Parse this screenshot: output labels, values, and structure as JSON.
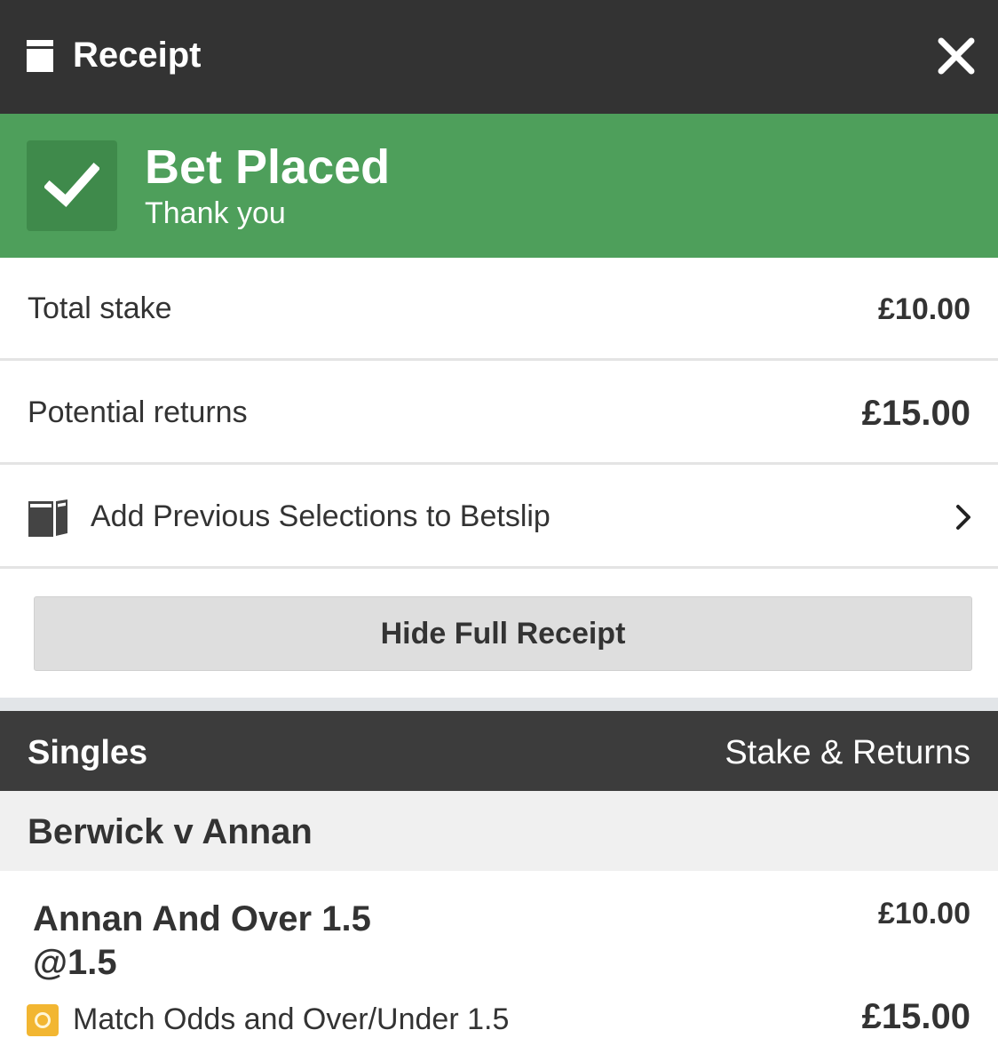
{
  "header": {
    "title": "Receipt",
    "icons": {
      "receipt": "receipt-icon",
      "close": "close-icon"
    }
  },
  "banner": {
    "title": "Bet Placed",
    "subtitle": "Thank you",
    "icon": "checkmark-icon",
    "color": "#4e9f5b"
  },
  "summary": {
    "total_stake_label": "Total stake",
    "total_stake_value": "£10.00",
    "potential_returns_label": "Potential returns",
    "potential_returns_value": "£15.00"
  },
  "add_previous": {
    "label": "Add Previous Selections to Betslip",
    "icon": "betslip-icon",
    "chevron": "chevron-right-icon"
  },
  "hide_button": {
    "label": "Hide Full Receipt"
  },
  "singles": {
    "left_label": "Singles",
    "right_label": "Stake & Returns"
  },
  "event": {
    "name": "Berwick v Annan"
  },
  "bet": {
    "selection": "Annan And Over 1.5",
    "odds": "@1.5",
    "market": "Match Odds and Over/Under 1.5",
    "market_icon": "market-icon",
    "stake": "£10.00",
    "returns": "£15.00"
  }
}
